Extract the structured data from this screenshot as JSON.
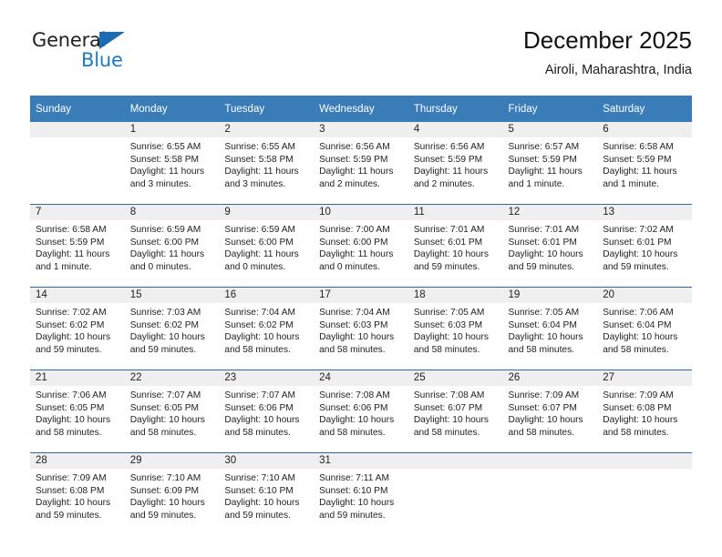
{
  "logo": {
    "word_one": "General",
    "word_two": "Blue",
    "triangle_icon": "triangle-icon",
    "brand_blue": "#1e7ac4",
    "brand_dark": "#231f20"
  },
  "header": {
    "title": "December 2025",
    "subtitle": "Airoli, Maharashtra, India"
  },
  "theme": {
    "header_blue": "#3a7cb8",
    "rule_blue": "#2c6aa8",
    "daynum_gray": "#efefef"
  },
  "weekdays": [
    "Sunday",
    "Monday",
    "Tuesday",
    "Wednesday",
    "Thursday",
    "Friday",
    "Saturday"
  ],
  "labels": {
    "sunrise": "Sunrise:",
    "sunset": "Sunset:",
    "daylight": "Daylight:"
  },
  "weeks": [
    [
      {
        "day": "",
        "sunrise": "",
        "sunset": "",
        "daylight": "",
        "empty": true
      },
      {
        "day": "1",
        "sunrise": "Sunrise: 6:55 AM",
        "sunset": "Sunset: 5:58 PM",
        "daylight": "Daylight: 11 hours and 3 minutes."
      },
      {
        "day": "2",
        "sunrise": "Sunrise: 6:55 AM",
        "sunset": "Sunset: 5:58 PM",
        "daylight": "Daylight: 11 hours and 3 minutes."
      },
      {
        "day": "3",
        "sunrise": "Sunrise: 6:56 AM",
        "sunset": "Sunset: 5:59 PM",
        "daylight": "Daylight: 11 hours and 2 minutes."
      },
      {
        "day": "4",
        "sunrise": "Sunrise: 6:56 AM",
        "sunset": "Sunset: 5:59 PM",
        "daylight": "Daylight: 11 hours and 2 minutes."
      },
      {
        "day": "5",
        "sunrise": "Sunrise: 6:57 AM",
        "sunset": "Sunset: 5:59 PM",
        "daylight": "Daylight: 11 hours and 1 minute."
      },
      {
        "day": "6",
        "sunrise": "Sunrise: 6:58 AM",
        "sunset": "Sunset: 5:59 PM",
        "daylight": "Daylight: 11 hours and 1 minute."
      }
    ],
    [
      {
        "day": "7",
        "sunrise": "Sunrise: 6:58 AM",
        "sunset": "Sunset: 5:59 PM",
        "daylight": "Daylight: 11 hours and 1 minute."
      },
      {
        "day": "8",
        "sunrise": "Sunrise: 6:59 AM",
        "sunset": "Sunset: 6:00 PM",
        "daylight": "Daylight: 11 hours and 0 minutes."
      },
      {
        "day": "9",
        "sunrise": "Sunrise: 6:59 AM",
        "sunset": "Sunset: 6:00 PM",
        "daylight": "Daylight: 11 hours and 0 minutes."
      },
      {
        "day": "10",
        "sunrise": "Sunrise: 7:00 AM",
        "sunset": "Sunset: 6:00 PM",
        "daylight": "Daylight: 11 hours and 0 minutes."
      },
      {
        "day": "11",
        "sunrise": "Sunrise: 7:01 AM",
        "sunset": "Sunset: 6:01 PM",
        "daylight": "Daylight: 10 hours and 59 minutes."
      },
      {
        "day": "12",
        "sunrise": "Sunrise: 7:01 AM",
        "sunset": "Sunset: 6:01 PM",
        "daylight": "Daylight: 10 hours and 59 minutes."
      },
      {
        "day": "13",
        "sunrise": "Sunrise: 7:02 AM",
        "sunset": "Sunset: 6:01 PM",
        "daylight": "Daylight: 10 hours and 59 minutes."
      }
    ],
    [
      {
        "day": "14",
        "sunrise": "Sunrise: 7:02 AM",
        "sunset": "Sunset: 6:02 PM",
        "daylight": "Daylight: 10 hours and 59 minutes."
      },
      {
        "day": "15",
        "sunrise": "Sunrise: 7:03 AM",
        "sunset": "Sunset: 6:02 PM",
        "daylight": "Daylight: 10 hours and 59 minutes."
      },
      {
        "day": "16",
        "sunrise": "Sunrise: 7:04 AM",
        "sunset": "Sunset: 6:02 PM",
        "daylight": "Daylight: 10 hours and 58 minutes."
      },
      {
        "day": "17",
        "sunrise": "Sunrise: 7:04 AM",
        "sunset": "Sunset: 6:03 PM",
        "daylight": "Daylight: 10 hours and 58 minutes."
      },
      {
        "day": "18",
        "sunrise": "Sunrise: 7:05 AM",
        "sunset": "Sunset: 6:03 PM",
        "daylight": "Daylight: 10 hours and 58 minutes."
      },
      {
        "day": "19",
        "sunrise": "Sunrise: 7:05 AM",
        "sunset": "Sunset: 6:04 PM",
        "daylight": "Daylight: 10 hours and 58 minutes."
      },
      {
        "day": "20",
        "sunrise": "Sunrise: 7:06 AM",
        "sunset": "Sunset: 6:04 PM",
        "daylight": "Daylight: 10 hours and 58 minutes."
      }
    ],
    [
      {
        "day": "21",
        "sunrise": "Sunrise: 7:06 AM",
        "sunset": "Sunset: 6:05 PM",
        "daylight": "Daylight: 10 hours and 58 minutes."
      },
      {
        "day": "22",
        "sunrise": "Sunrise: 7:07 AM",
        "sunset": "Sunset: 6:05 PM",
        "daylight": "Daylight: 10 hours and 58 minutes."
      },
      {
        "day": "23",
        "sunrise": "Sunrise: 7:07 AM",
        "sunset": "Sunset: 6:06 PM",
        "daylight": "Daylight: 10 hours and 58 minutes."
      },
      {
        "day": "24",
        "sunrise": "Sunrise: 7:08 AM",
        "sunset": "Sunset: 6:06 PM",
        "daylight": "Daylight: 10 hours and 58 minutes."
      },
      {
        "day": "25",
        "sunrise": "Sunrise: 7:08 AM",
        "sunset": "Sunset: 6:07 PM",
        "daylight": "Daylight: 10 hours and 58 minutes."
      },
      {
        "day": "26",
        "sunrise": "Sunrise: 7:09 AM",
        "sunset": "Sunset: 6:07 PM",
        "daylight": "Daylight: 10 hours and 58 minutes."
      },
      {
        "day": "27",
        "sunrise": "Sunrise: 7:09 AM",
        "sunset": "Sunset: 6:08 PM",
        "daylight": "Daylight: 10 hours and 58 minutes."
      }
    ],
    [
      {
        "day": "28",
        "sunrise": "Sunrise: 7:09 AM",
        "sunset": "Sunset: 6:08 PM",
        "daylight": "Daylight: 10 hours and 59 minutes."
      },
      {
        "day": "29",
        "sunrise": "Sunrise: 7:10 AM",
        "sunset": "Sunset: 6:09 PM",
        "daylight": "Daylight: 10 hours and 59 minutes."
      },
      {
        "day": "30",
        "sunrise": "Sunrise: 7:10 AM",
        "sunset": "Sunset: 6:10 PM",
        "daylight": "Daylight: 10 hours and 59 minutes."
      },
      {
        "day": "31",
        "sunrise": "Sunrise: 7:11 AM",
        "sunset": "Sunset: 6:10 PM",
        "daylight": "Daylight: 10 hours and 59 minutes."
      },
      {
        "day": "",
        "sunrise": "",
        "sunset": "",
        "daylight": "",
        "empty": true
      },
      {
        "day": "",
        "sunrise": "",
        "sunset": "",
        "daylight": "",
        "empty": true
      },
      {
        "day": "",
        "sunrise": "",
        "sunset": "",
        "daylight": "",
        "empty": true
      }
    ]
  ]
}
